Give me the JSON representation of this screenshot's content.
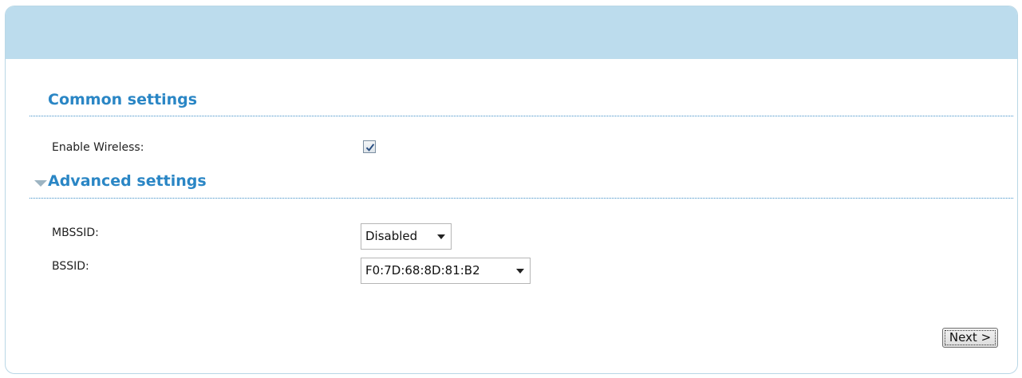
{
  "common": {
    "title": "Common settings",
    "enable_wireless_label": "Enable Wireless:",
    "enable_wireless_checked": true
  },
  "advanced": {
    "title": "Advanced settings",
    "expanded": true,
    "mbssid_label": "MBSSID:",
    "mbssid_value": "Disabled",
    "bssid_label": "BSSID:",
    "bssid_value": "F0:7D:68:8D:81:B2"
  },
  "actions": {
    "next_label": "Next >"
  },
  "colors": {
    "header_bg": "#bcdced",
    "section_title": "#2a86c5",
    "divider": "#3c8ec7"
  }
}
